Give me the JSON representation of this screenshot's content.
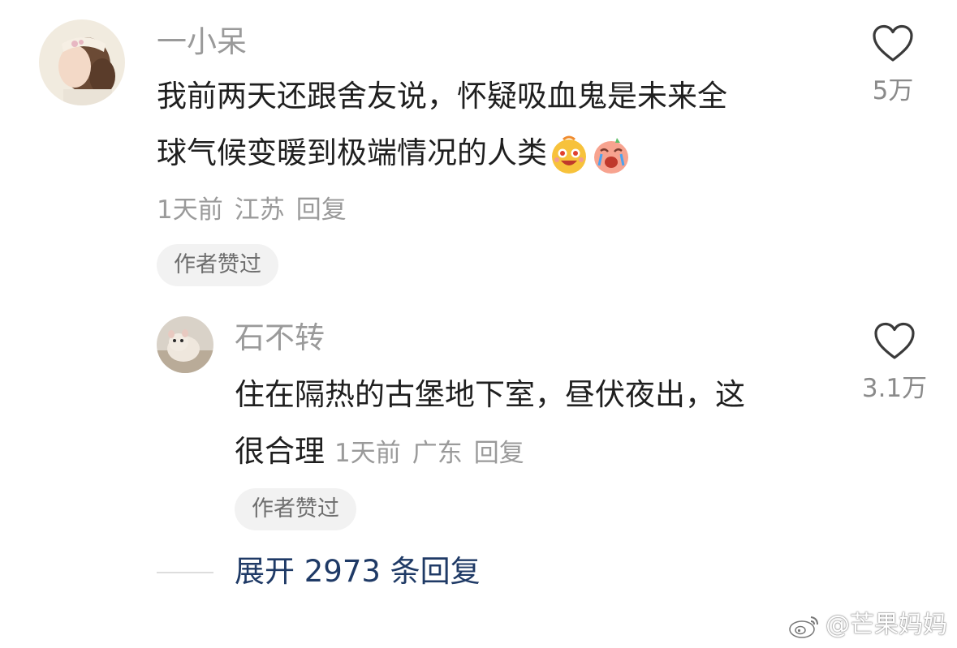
{
  "comments": [
    {
      "username": "一小呆",
      "text_line1": "我前两天还跟舍友说，怀疑吸血鬼是未来全",
      "text_line2": "球气候变暖到极端情况的人类",
      "time": "1天前",
      "location": "江苏",
      "reply_label": "回复",
      "badge": "作者赞过",
      "likes": "5万",
      "emojis": [
        "happy-cheering-emoji",
        "crying-laughing-emoji"
      ]
    },
    {
      "username": "石不转",
      "text_line1": "住在隔热的古堡地下室，昼伏夜出，这",
      "text_line2": "很合理",
      "time": "1天前",
      "location": "广东",
      "reply_label": "回复",
      "badge": "作者赞过",
      "likes": "3.1万"
    }
  ],
  "expand_replies": "展开 2973 条回复",
  "watermark": "@芒果妈妈",
  "colors": {
    "background": "#ffffff",
    "username": "#9a9a9a",
    "text": "#1f1f1f",
    "link": "#1f3a66",
    "badge_bg": "#f2f2f2"
  }
}
